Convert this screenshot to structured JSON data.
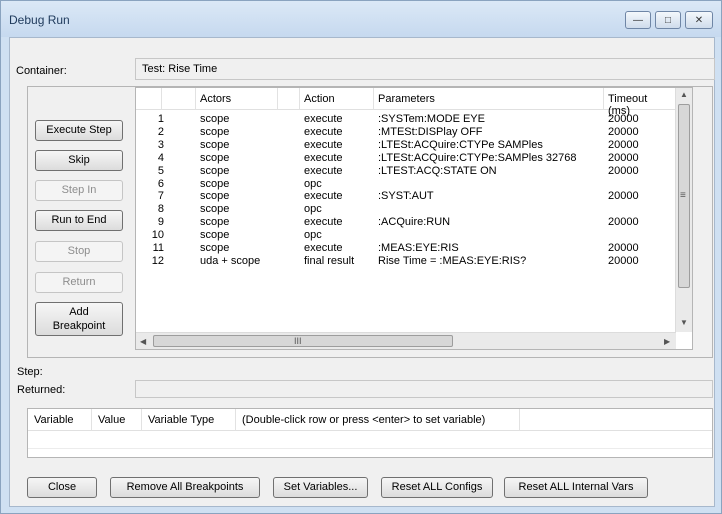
{
  "window": {
    "title": "Debug Run",
    "controls": {
      "minimize": "—",
      "maximize": "□",
      "close": "✕"
    }
  },
  "container": {
    "label": "Container:",
    "value": "Test: Rise Time"
  },
  "side_buttons": {
    "execute_step": "Execute Step",
    "skip": "Skip",
    "step_in": "Step In",
    "run_to_end": "Run to End",
    "stop": "Stop",
    "return": "Return",
    "add_breakpoint_line1": "Add",
    "add_breakpoint_line2": "Breakpoint"
  },
  "steps_table": {
    "columns": [
      "",
      "Actors",
      "Action",
      "Parameters",
      "Timeout (ms)"
    ],
    "rows": [
      {
        "num": "1",
        "actor": "scope",
        "action": "execute",
        "params": ":SYSTem:MODE EYE",
        "timeout": "20000"
      },
      {
        "num": "2",
        "actor": "scope",
        "action": "execute",
        "params": ":MTESt:DISPlay OFF",
        "timeout": "20000"
      },
      {
        "num": "3",
        "actor": "scope",
        "action": "execute",
        "params": ":LTESt:ACQuire:CTYPe SAMPles",
        "timeout": "20000"
      },
      {
        "num": "4",
        "actor": "scope",
        "action": "execute",
        "params": ":LTESt:ACQuire:CTYPe:SAMPles 32768",
        "timeout": "20000"
      },
      {
        "num": "5",
        "actor": "scope",
        "action": "execute",
        "params": ":LTEST:ACQ:STATE ON",
        "timeout": "20000"
      },
      {
        "num": "6",
        "actor": "scope",
        "action": "opc",
        "params": "",
        "timeout": ""
      },
      {
        "num": "7",
        "actor": "scope",
        "action": "execute",
        "params": ":SYST:AUT",
        "timeout": "20000"
      },
      {
        "num": "8",
        "actor": "scope",
        "action": "opc",
        "params": "",
        "timeout": ""
      },
      {
        "num": "9",
        "actor": "scope",
        "action": "execute",
        "params": ":ACQuire:RUN",
        "timeout": "20000"
      },
      {
        "num": "10",
        "actor": "scope",
        "action": "opc",
        "params": "",
        "timeout": ""
      },
      {
        "num": "11",
        "actor": "scope",
        "action": "execute",
        "params": ":MEAS:EYE:RIS",
        "timeout": "20000"
      },
      {
        "num": "12",
        "actor": "uda + scope",
        "action": "final result",
        "params": "Rise Time = :MEAS:EYE:RIS?",
        "timeout": "20000"
      }
    ]
  },
  "scroll_glyphs": {
    "up": "▲",
    "down": "▼",
    "left": "◀",
    "right": "▶",
    "grip_v": "≡",
    "grip_h": "III"
  },
  "step_label": "Step:",
  "returned_label": "Returned:",
  "variables_table": {
    "columns": [
      "Variable",
      "Value",
      "Variable Type",
      "(Double-click row or press <enter> to set variable)"
    ]
  },
  "bottom_buttons": {
    "close": "Close",
    "remove_breakpoints": "Remove All Breakpoints",
    "set_variables": "Set Variables...",
    "reset_configs": "Reset ALL Configs",
    "reset_internal_vars": "Reset ALL Internal Vars"
  },
  "colors": {
    "titlebar": "#c6d9ef",
    "client": "#f0f0f0",
    "grid": "#ffffff"
  }
}
